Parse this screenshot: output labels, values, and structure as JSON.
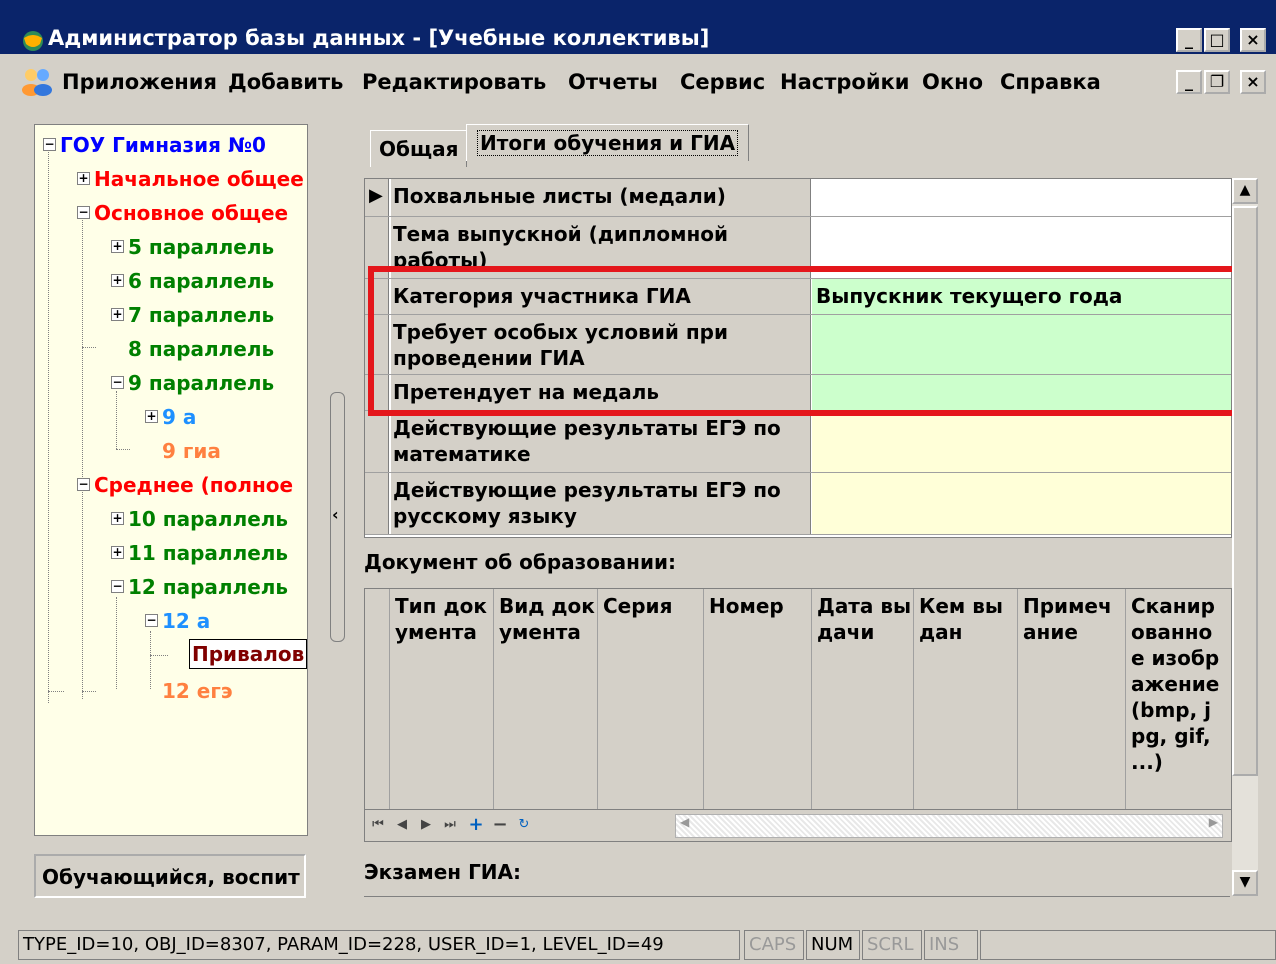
{
  "window": {
    "title": "Администратор базы данных - [Учебные коллективы]"
  },
  "menu": [
    "Приложения",
    "Добавить",
    "Редактировать",
    "Отчеты",
    "Сервис",
    "Настройки",
    "Окно",
    "Справка"
  ],
  "tree": {
    "nodes": [
      {
        "label": "ГОУ Гимназия №0",
        "color": "#0000ff",
        "box": "−"
      },
      {
        "label": "Начальное общее",
        "color": "#ff0000",
        "box": "+"
      },
      {
        "label": "Основное общее",
        "color": "#ff0000",
        "box": "−"
      },
      {
        "label": "5 параллель",
        "color": "#008000",
        "box": "+"
      },
      {
        "label": "6 параллель",
        "color": "#008000",
        "box": "+"
      },
      {
        "label": "7 параллель",
        "color": "#008000",
        "box": "+"
      },
      {
        "label": "8 параллель",
        "color": "#008000",
        "box": ""
      },
      {
        "label": "9 параллель",
        "color": "#008000",
        "box": "−"
      },
      {
        "label": "9 а",
        "color": "#1e90ff",
        "box": "+"
      },
      {
        "label": "9 гиа",
        "color": "#ff8040",
        "box": ""
      },
      {
        "label": "Среднее (полное",
        "color": "#ff0000",
        "box": "−"
      },
      {
        "label": "10 параллель",
        "color": "#008000",
        "box": "+"
      },
      {
        "label": "11 параллель",
        "color": "#008000",
        "box": "+"
      },
      {
        "label": "12 параллель",
        "color": "#008000",
        "box": "−"
      },
      {
        "label": "12 а",
        "color": "#1e90ff",
        "box": "−"
      },
      {
        "label": "Привалов",
        "color": "#800000",
        "box": ""
      },
      {
        "label": "12 егэ",
        "color": "#ff8040",
        "box": ""
      }
    ],
    "status": "Обучающийся, воспит"
  },
  "tabs": [
    "Общая",
    "Итоги обучения и ГИА"
  ],
  "grid": {
    "rows": [
      {
        "label": "Похвальные листы (медали)",
        "value": ""
      },
      {
        "label": "Тема выпускной (дипломной работы)",
        "value": ""
      },
      {
        "label": "Категория участника ГИА",
        "value": "Выпускник текущего года"
      },
      {
        "label": "Требует особых условий при проведении ГИА",
        "value": ""
      },
      {
        "label": "Претендует на медаль",
        "value": ""
      },
      {
        "label": "Действующие результаты ЕГЭ по математике",
        "value": ""
      },
      {
        "label": "Действующие результаты ЕГЭ по русскому языку",
        "value": ""
      }
    ]
  },
  "doc_section": {
    "title": "Документ об образовании:",
    "columns": [
      "Тип документа",
      "Вид документа",
      "Серия",
      "Номер",
      "Дата выдачи",
      "Кем выдан",
      "Примечание",
      "Сканированное изображение (bmp, jpg, gif, ...)"
    ]
  },
  "exam_section": {
    "title": "Экзамен ГИА:"
  },
  "statusbar": {
    "info": "TYPE_ID=10, OBJ_ID=8307, PARAM_ID=228, USER_ID=1, LEVEL_ID=49",
    "caps": "CAPS",
    "num": "NUM",
    "scrl": "SCRL",
    "ins": "INS"
  },
  "colors": {
    "titlebar": "#0a246a",
    "highlight": "#e4161b",
    "green_row": "#ccffcc",
    "yellow_row": "#ffffd8"
  }
}
